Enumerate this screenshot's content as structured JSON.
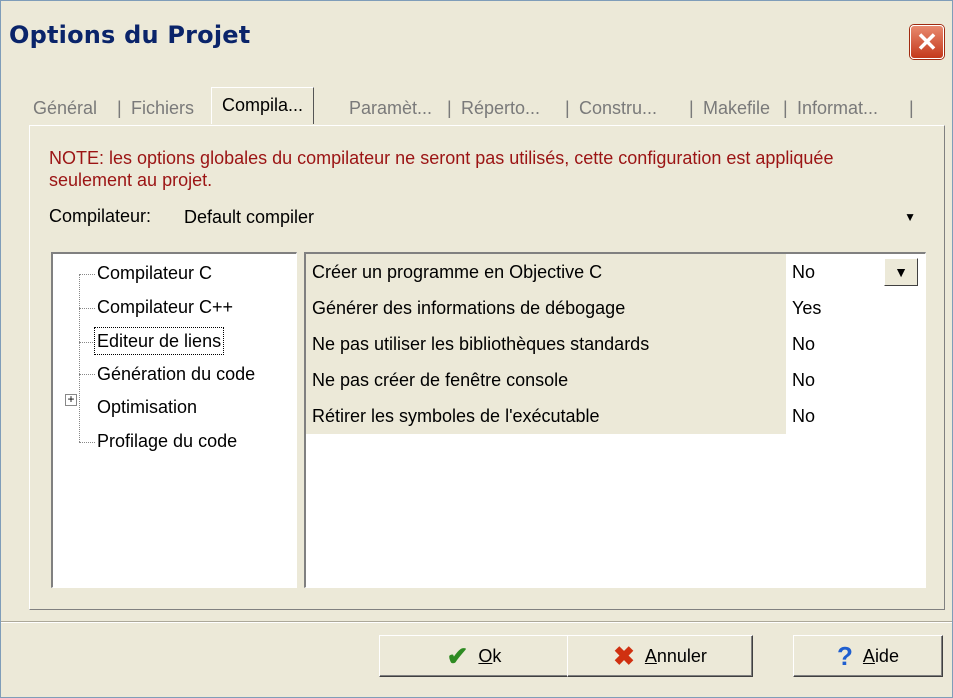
{
  "window": {
    "title": "Options du Projet"
  },
  "tabs": [
    {
      "label": "Général",
      "active": false
    },
    {
      "label": "Fichiers",
      "active": false
    },
    {
      "label": "Compila...",
      "active": true
    },
    {
      "label": "Paramèt...",
      "active": false
    },
    {
      "label": "Réperto...",
      "active": false
    },
    {
      "label": "Constru...",
      "active": false
    },
    {
      "label": "Makefile",
      "active": false
    },
    {
      "label": "Informat...",
      "active": false
    }
  ],
  "note": "NOTE: les options globales du compilateur ne seront pas utilisés, cette configuration est appliquée seulement au projet.",
  "compiler": {
    "label": "Compilateur:",
    "value": "Default compiler"
  },
  "tree": {
    "items": [
      {
        "label": "Compilateur C"
      },
      {
        "label": "Compilateur C++"
      },
      {
        "label": "Editeur de liens",
        "selected": true
      },
      {
        "label": "Génération du code"
      },
      {
        "label": "Optimisation",
        "expandable": true
      },
      {
        "label": "Profilage du code"
      }
    ]
  },
  "options": [
    {
      "name": "Créer un programme en Objective C",
      "value": "No"
    },
    {
      "name": "Générer des informations de débogage",
      "value": "Yes"
    },
    {
      "name": "Ne pas utiliser les bibliothèques standards",
      "value": "No"
    },
    {
      "name": "Ne pas créer de fenêtre console",
      "value": "No"
    },
    {
      "name": "Rétirer les symboles de l'exécutable",
      "value": "No"
    }
  ],
  "buttons": {
    "ok": {
      "accel": "O",
      "rest": "k"
    },
    "cancel": {
      "accel": "A",
      "rest": "nnuler"
    },
    "help": {
      "accel": "A",
      "rest": "ide"
    }
  },
  "colors": {
    "note": "#9b1414",
    "title": "#0a246a",
    "ok_icon": "#2e8b22",
    "cancel_icon": "#d03010",
    "help_icon": "#1f5fd0"
  }
}
